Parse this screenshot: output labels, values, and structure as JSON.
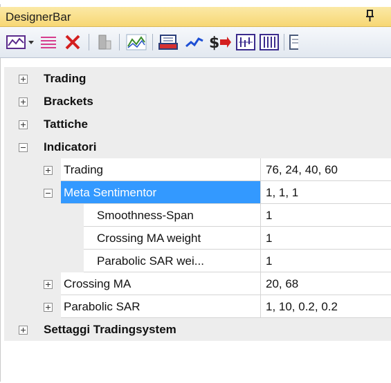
{
  "panel": {
    "title": "DesignerBar",
    "pin_glyph": "q",
    "accent_color": "#3399ff",
    "title_bar_color": "#f7d774"
  },
  "toolbar": {
    "icons": [
      "chart-icon",
      "dropdown-arrow-icon",
      "lines-icon",
      "delete-icon",
      "block-icon",
      "indicator-icon",
      "keyboard-icon",
      "wave-icon",
      "dollar-arrow-icon",
      "bars-chart-icon",
      "table-icon",
      "page-icon"
    ]
  },
  "categories": {
    "trading": "Trading",
    "brackets": "Brackets",
    "tattiche": "Tattiche",
    "indicatori": "Indicatori",
    "settaggi": "Settaggi Tradingsystem"
  },
  "properties": {
    "trading": {
      "name": "Trading",
      "value": "76, 24, 40, 60"
    },
    "meta": {
      "name": "Meta Sentimentor",
      "value": "1, 1, 1"
    },
    "smooth": {
      "name": "Smoothness-Span",
      "value": "1"
    },
    "crossing_weight": {
      "name": "Crossing MA weight",
      "value": "1"
    },
    "parabolic_weight": {
      "name": "Parabolic SAR wei...",
      "value": "1"
    },
    "crossing_ma": {
      "name": "Crossing MA",
      "value": "20, 68"
    },
    "parabolic_sar": {
      "name": "Parabolic SAR",
      "value": "1, 10, 0.2, 0.2"
    }
  }
}
